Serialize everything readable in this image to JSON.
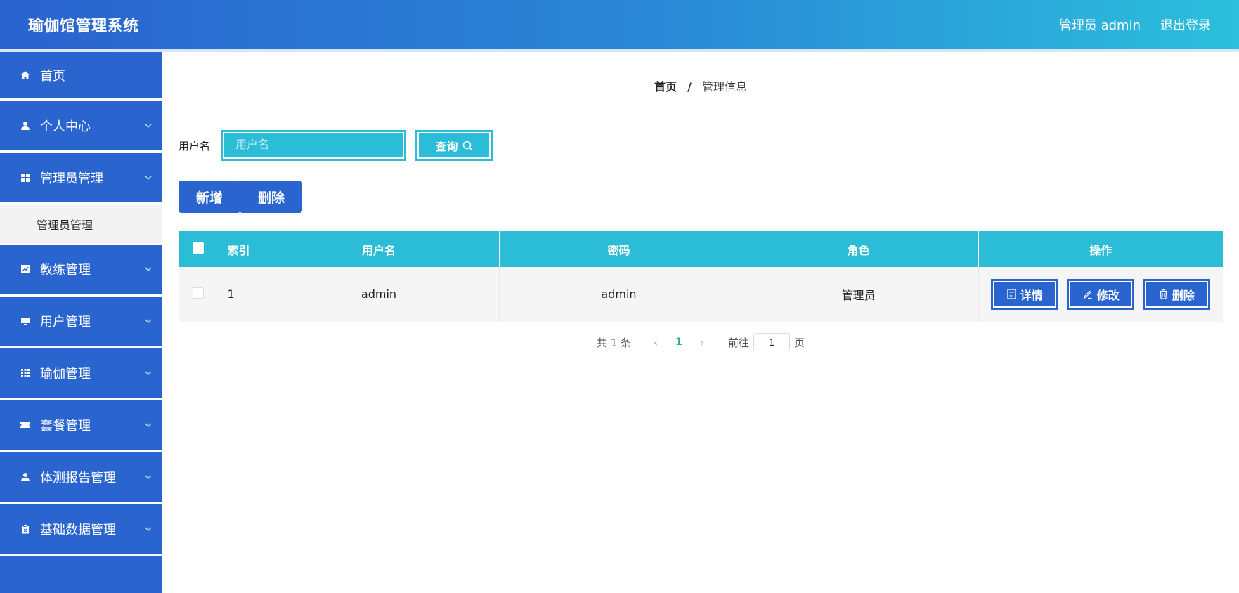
{
  "header": {
    "title": "瑜伽馆管理系统",
    "user": "管理员 admin",
    "logout": "退出登录"
  },
  "sidebar": {
    "items": [
      {
        "label": "首页",
        "icon": "home-icon"
      },
      {
        "label": "个人中心",
        "icon": "user-icon"
      },
      {
        "label": "管理员管理",
        "icon": "grid-icon",
        "sub": "管理员管理"
      },
      {
        "label": "教练管理",
        "icon": "chart-icon"
      },
      {
        "label": "用户管理",
        "icon": "monitor-icon"
      },
      {
        "label": "瑜伽管理",
        "icon": "apps-icon"
      },
      {
        "label": "套餐管理",
        "icon": "ticket-icon"
      },
      {
        "label": "体测报告管理",
        "icon": "person-icon"
      },
      {
        "label": "基础数据管理",
        "icon": "clipboard-icon"
      }
    ]
  },
  "breadcrumb": {
    "home": "首页",
    "sep": "/",
    "current": "管理信息"
  },
  "search": {
    "label": "用户名",
    "placeholder": "用户名",
    "button": "查询"
  },
  "actions": {
    "add": "新增",
    "delete": "删除"
  },
  "table": {
    "columns": [
      "索引",
      "用户名",
      "密码",
      "角色",
      "操作"
    ],
    "rows": [
      {
        "index": "1",
        "username": "admin",
        "password": "admin",
        "role": "管理员"
      }
    ],
    "ops": {
      "detail": "详情",
      "edit": "修改",
      "delete": "删除"
    }
  },
  "pager": {
    "total": "共 1 条",
    "page": "1",
    "goto_label": "前往",
    "goto_value": "1",
    "goto_unit": "页"
  },
  "colors": {
    "primary": "#2a65cf",
    "accent": "#2bbcd8"
  }
}
